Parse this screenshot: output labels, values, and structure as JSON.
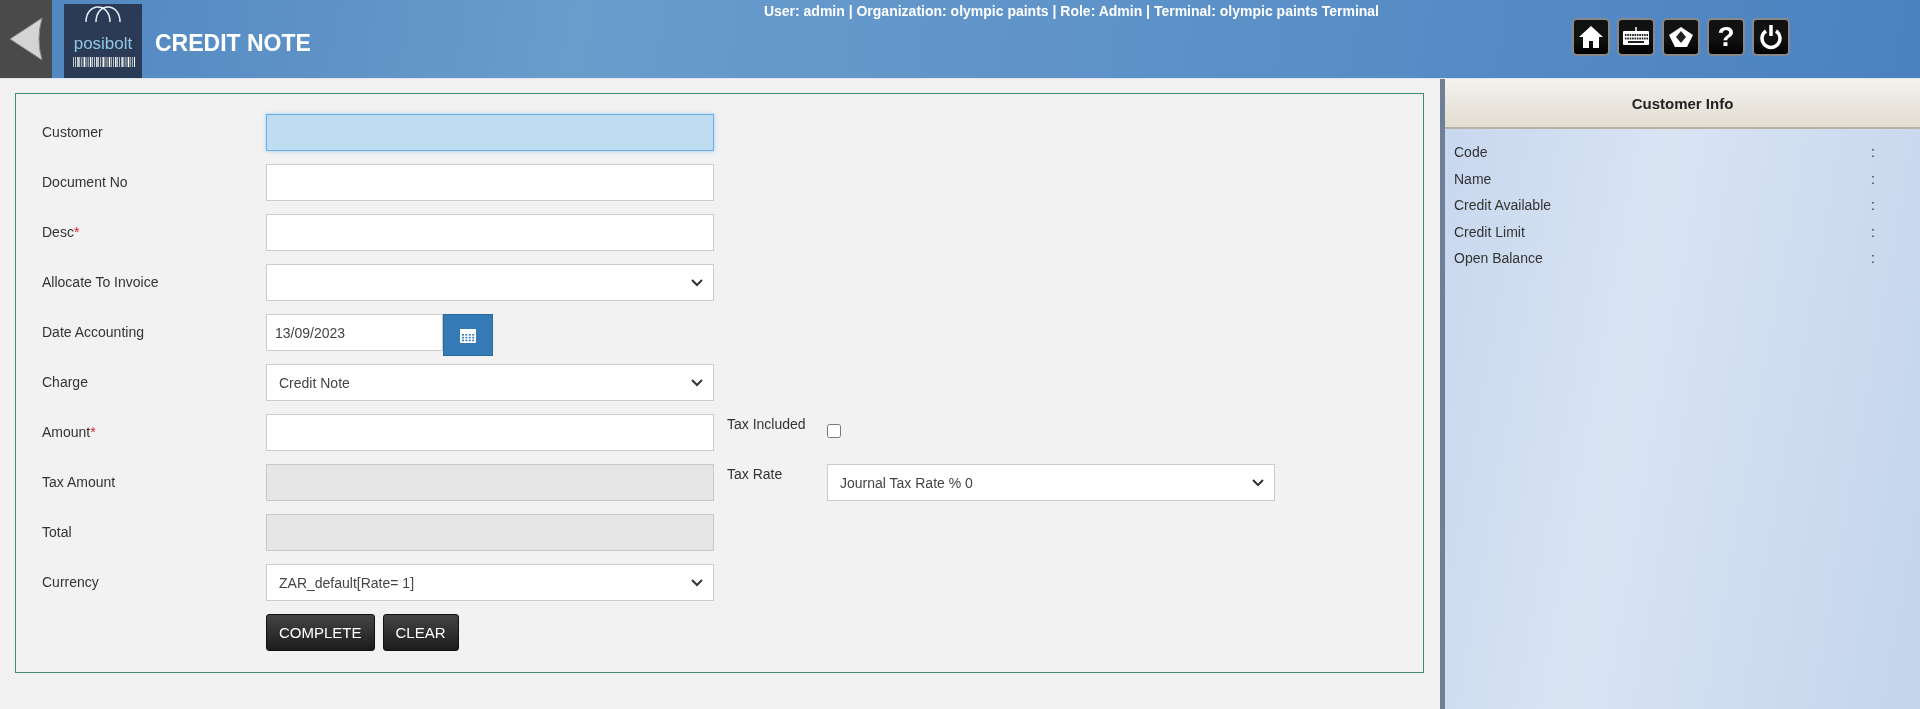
{
  "header": {
    "logo_text": "posibolt",
    "title": "CREDIT NOTE",
    "session_info": "User: admin | Organization: olympic paints | Role: Admin | Terminal: olympic paints Terminal",
    "toolbar": [
      {
        "kind": "home"
      },
      {
        "kind": "keyboard"
      },
      {
        "kind": "shape"
      },
      {
        "kind": "help",
        "glyph": "?"
      },
      {
        "kind": "power"
      }
    ]
  },
  "form": {
    "fields": [
      {
        "label": "Customer",
        "kind": "text",
        "focused": true,
        "disabled": false
      },
      {
        "label": "Document No",
        "kind": "text",
        "focused": false,
        "disabled": false
      },
      {
        "label": "Desc",
        "required_mark": "*",
        "kind": "text",
        "focused": false,
        "disabled": false
      },
      {
        "label": "Allocate To Invoice",
        "kind": "select",
        "focused": false,
        "disabled": false
      },
      {
        "label": "Date Accounting",
        "kind": "date",
        "value": "13/09/2023",
        "focused": false,
        "disabled": false
      },
      {
        "label": "Charge",
        "kind": "select",
        "value": "Credit Note",
        "focused": false,
        "disabled": false
      },
      {
        "label": "Amount",
        "required_mark": "*",
        "kind": "text",
        "focused": false,
        "disabled": false,
        "side": {
          "label": "Tax Included",
          "kind": "checkbox",
          "checked": false
        }
      },
      {
        "label": "Tax Amount",
        "kind": "text",
        "focused": false,
        "disabled": true,
        "side": {
          "label": "Tax Rate",
          "kind": "select",
          "value": "Journal Tax Rate % 0"
        }
      },
      {
        "label": "Total",
        "kind": "text",
        "focused": false,
        "disabled": true
      },
      {
        "label": "Currency",
        "kind": "select",
        "value": "ZAR_default[Rate= 1]",
        "focused": false,
        "disabled": false
      }
    ],
    "buttons": [
      "COMPLETE",
      "CLEAR"
    ]
  },
  "customer_info": {
    "title": "Customer Info",
    "rows": [
      {
        "label": "Code",
        "separator": ":"
      },
      {
        "label": "Name",
        "separator": ":"
      },
      {
        "label": "Credit Available",
        "separator": ":"
      },
      {
        "label": "Credit Limit",
        "separator": ":"
      },
      {
        "label": "Open Balance",
        "separator": ":"
      }
    ]
  }
}
